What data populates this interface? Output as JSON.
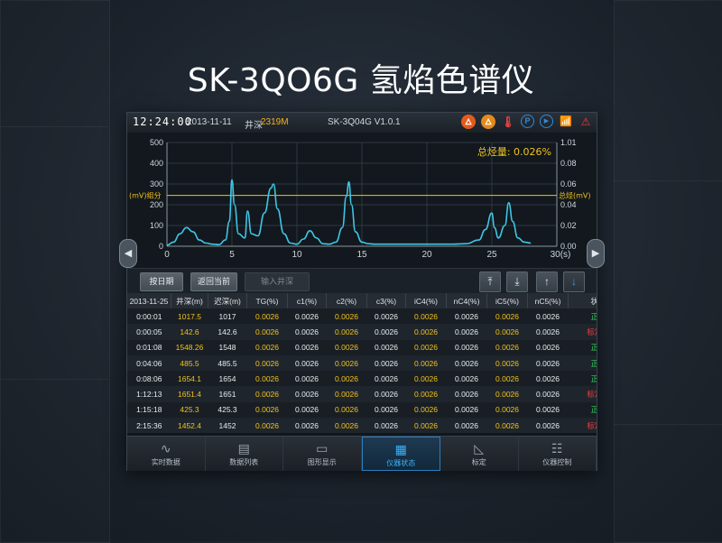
{
  "headline": "SK-3QO6G 氢焰色谱仪",
  "statusbar": {
    "time": "12:24:00",
    "date": "2013-11-11",
    "depth_label": "井深",
    "depth_value": "2319M",
    "version": "SK-3Q04G V1.0.1",
    "icons": [
      "flame-icon",
      "flame-icon",
      "thermometer-icon",
      "parking-icon",
      "play-icon",
      "signal-icon",
      "warning-icon"
    ]
  },
  "chart_data": {
    "type": "line",
    "annotation": "总烃量: 0.026%",
    "left_axis_label": "(mV)组分",
    "right_axis_label": "总烃(mV)",
    "xlim": [
      0,
      30
    ],
    "x_ticks": [
      "0",
      "5",
      "10",
      "15",
      "20",
      "25",
      "30(s)"
    ],
    "ylim_left": [
      0,
      500
    ],
    "y_ticks_left": [
      "0",
      "100",
      "200",
      "300",
      "400",
      "500"
    ],
    "ylim_right": [
      0,
      1.01
    ],
    "y_ticks_right": [
      "0.00",
      "0.02",
      "0.04",
      "0.06",
      "0.08",
      "1.01"
    ],
    "threshold_left": 245,
    "colors": {
      "line": "#3fc6e6",
      "threshold": "#f2c21c",
      "grid": "#2f3840",
      "annotation": "#f2c21c"
    },
    "series": [
      {
        "x": [
          0,
          0.5,
          1,
          1.5,
          2,
          2.5,
          3,
          3.5,
          4,
          4.5,
          4.8,
          5,
          5.2,
          5.5,
          6,
          6.2,
          6.5,
          7,
          7.5,
          8,
          8.2,
          8.5,
          9,
          9.5,
          10,
          10.5,
          11,
          11.5,
          12,
          12.5,
          13,
          13.5,
          13.8,
          14,
          14.2,
          14.5,
          15,
          15.5,
          16,
          17,
          18,
          19,
          20,
          21,
          22,
          23,
          24,
          24.5,
          25,
          25.2,
          25.5,
          26,
          26.3,
          26.6,
          27,
          27.5,
          28
        ],
        "y": [
          5,
          20,
          60,
          90,
          70,
          30,
          15,
          10,
          8,
          30,
          120,
          320,
          200,
          60,
          40,
          170,
          60,
          50,
          160,
          280,
          300,
          180,
          60,
          15,
          10,
          35,
          75,
          40,
          12,
          10,
          20,
          90,
          240,
          310,
          200,
          70,
          20,
          12,
          10,
          10,
          10,
          10,
          10,
          10,
          10,
          12,
          30,
          80,
          160,
          90,
          40,
          100,
          210,
          120,
          40,
          20,
          15
        ]
      }
    ]
  },
  "toolbar": {
    "by_date": "按日期",
    "back_current": "返回当前",
    "input_depth": "输入井深",
    "arrows": [
      "top-arrow-icon",
      "bottom-arrow-icon",
      "up-arrow-icon",
      "down-arrow-icon"
    ]
  },
  "table": {
    "headers": [
      "2013-11-25",
      "井深(m)",
      "迟深(m)",
      "TG(%)",
      "c1(%)",
      "c2(%)",
      "c3(%)",
      "iC4(%)",
      "nC4(%)",
      "iC5(%)",
      "nC5(%)",
      "状态"
    ],
    "rows": [
      [
        "0:00:01",
        "1017.5",
        "1017",
        "0.0026",
        "0.0026",
        "0.0026",
        "0.0026",
        "0.0026",
        "0.0026",
        "0.0026",
        "0.0026",
        "正常"
      ],
      [
        "0:00:05",
        "142.6",
        "142.6",
        "0.0026",
        "0.0026",
        "0.0026",
        "0.0026",
        "0.0026",
        "0.0026",
        "0.0026",
        "0.0026",
        "标定中"
      ],
      [
        "0:01:08",
        "1548.26",
        "1548",
        "0.0026",
        "0.0026",
        "0.0026",
        "0.0026",
        "0.0026",
        "0.0026",
        "0.0026",
        "0.0026",
        "正常"
      ],
      [
        "0:04:06",
        "485.5",
        "485.5",
        "0.0026",
        "0.0026",
        "0.0026",
        "0.0026",
        "0.0026",
        "0.0026",
        "0.0026",
        "0.0026",
        "正常"
      ],
      [
        "0:08:06",
        "1654.1",
        "1654",
        "0.0026",
        "0.0026",
        "0.0026",
        "0.0026",
        "0.0026",
        "0.0026",
        "0.0026",
        "0.0026",
        "正常"
      ],
      [
        "1:12:13",
        "1651.4",
        "1651",
        "0.0026",
        "0.0026",
        "0.0026",
        "0.0026",
        "0.0026",
        "0.0026",
        "0.0026",
        "0.0026",
        "标定中"
      ],
      [
        "1:15:18",
        "425.3",
        "425.3",
        "0.0026",
        "0.0026",
        "0.0026",
        "0.0026",
        "0.0026",
        "0.0026",
        "0.0026",
        "0.0026",
        "正常"
      ],
      [
        "2:15:36",
        "1452.4",
        "1452",
        "0.0026",
        "0.0026",
        "0.0026",
        "0.0026",
        "0.0026",
        "0.0026",
        "0.0026",
        "0.0026",
        "标定中"
      ]
    ],
    "status_colors": {
      "正常": "#2fd05a",
      "标定中": "#f23c3c"
    }
  },
  "side_arrows": {
    "left": "left-arrow-icon",
    "right": "right-arrow-icon"
  },
  "nav": {
    "items": [
      {
        "label": "实时数据",
        "icon": "waveform-icon",
        "active": false
      },
      {
        "label": "数据列表",
        "icon": "document-icon",
        "active": false
      },
      {
        "label": "图形显示",
        "icon": "monitor-icon",
        "active": false
      },
      {
        "label": "仪器状态",
        "icon": "calendar-icon",
        "active": true
      },
      {
        "label": "标定",
        "icon": "ruler-icon",
        "active": false
      },
      {
        "label": "仪器控制",
        "icon": "sliders-icon",
        "active": false
      }
    ]
  }
}
